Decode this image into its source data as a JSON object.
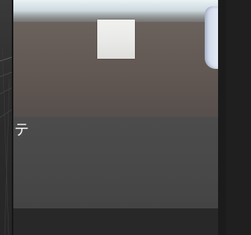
{
  "game_view": {
    "overlay_text": "テ"
  },
  "colors": {
    "sky": "#e6eef2",
    "ground_far": "#655b56",
    "ground_near": "#484848",
    "cube": "#e9e9e7",
    "side_object": "#dde5f2",
    "bottom_bar": "#282828",
    "editor_background": "#1e1e1e"
  }
}
